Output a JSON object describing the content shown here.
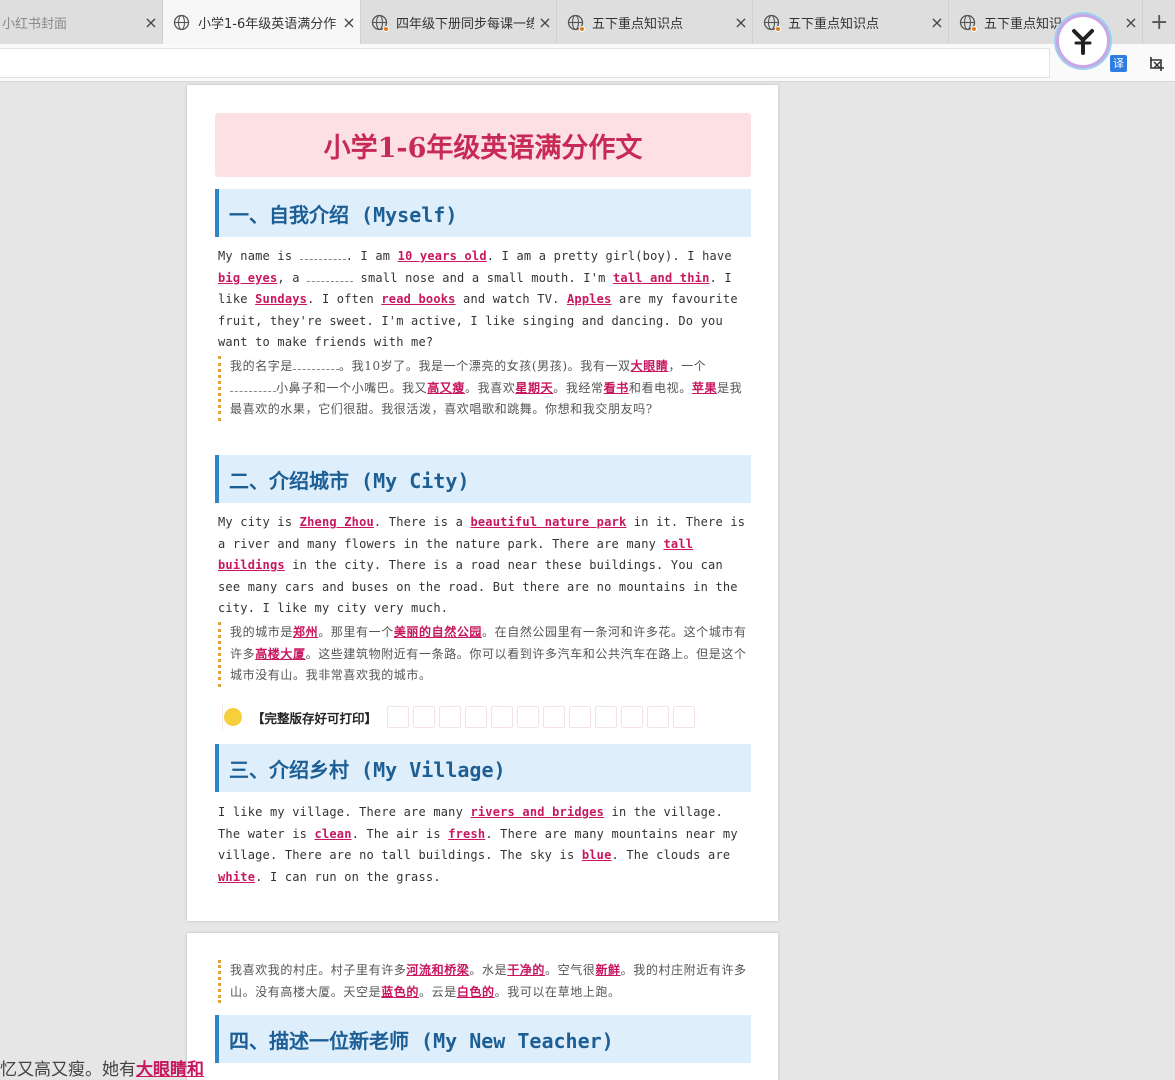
{
  "browser": {
    "tabs": [
      {
        "title": "小红书封面",
        "close": "×"
      },
      {
        "title": "小学1-6年级英语满分作",
        "close": "×"
      },
      {
        "title": "四年级下册同步每课一练",
        "close": "×"
      },
      {
        "title": "五下重点知识点",
        "close": "×"
      },
      {
        "title": "五下重点知识点",
        "close": "×"
      },
      {
        "title": "五下重点知识点",
        "close": "×"
      }
    ],
    "new_tab": "+",
    "translate_label": "译",
    "star": "☆"
  },
  "doc": {
    "title": "小学1-6年级英语满分作文",
    "sections": [
      {
        "heading": "一、自我介绍 (Myself)",
        "en": [
          {
            "t": "My name is "
          },
          {
            "blank": true
          },
          {
            "t": ". I am "
          },
          {
            "h": "10 years old"
          },
          {
            "t": ". I am a pretty girl(boy). I have "
          },
          {
            "h": "big eyes"
          },
          {
            "t": ", a "
          },
          {
            "blank": true
          },
          {
            "t": " small nose and a small mouth. I'm "
          },
          {
            "h": "tall and thin"
          },
          {
            "t": ". I like "
          },
          {
            "h": "Sundays"
          },
          {
            "t": ". I often "
          },
          {
            "h": "read books"
          },
          {
            "t": " and watch TV. "
          },
          {
            "h": "Apples"
          },
          {
            "t": " are my favourite fruit, they're sweet. I'm active, I like singing and dancing. Do you want to make friends with me?"
          }
        ],
        "cn": [
          {
            "t": "我的名字是"
          },
          {
            "blank": true
          },
          {
            "t": "。我10岁了。我是一个漂亮的女孩(男孩)。我有一双"
          },
          {
            "h": "大眼睛"
          },
          {
            "t": "，一个"
          },
          {
            "blank": true
          },
          {
            "t": "小鼻子和一个小嘴巴。我又"
          },
          {
            "h": "高又瘦"
          },
          {
            "t": "。我喜欢"
          },
          {
            "h": "星期天"
          },
          {
            "t": "。我经常"
          },
          {
            "h": "看书"
          },
          {
            "t": "和看电视。"
          },
          {
            "h": "苹果"
          },
          {
            "t": "是我最喜欢的水果，它们很甜。我很活泼，喜欢唱歌和跳舞。你想和我交朋友吗?"
          }
        ]
      },
      {
        "heading": "二、介绍城市 (My City)",
        "en": [
          {
            "t": "My city is "
          },
          {
            "h": "Zheng Zhou"
          },
          {
            "t": ". There is a "
          },
          {
            "h": "beautiful nature park"
          },
          {
            "t": " in it. There is a river and many flowers in the nature park. There are many "
          },
          {
            "h": "tall buildings"
          },
          {
            "t": " in the city. There is a road near these buildings. You can see many cars and buses on the road. But there are no mountains in the city. I like my city very much."
          }
        ],
        "cn": [
          {
            "t": "我的城市是"
          },
          {
            "h": "郑州"
          },
          {
            "t": "。那里有一个"
          },
          {
            "h": "美丽的自然公园"
          },
          {
            "t": "。在自然公园里有一条河和许多花。这个城市有许多"
          },
          {
            "h": "高楼大厦"
          },
          {
            "t": "。这些建筑物附近有一条路。你可以看到许多汽车和公共汽车在路上。但是这个城市没有山。我非常喜欢我的城市。"
          }
        ]
      },
      {
        "heading": "三、介绍乡村 (My Village)",
        "en": [
          {
            "t": "I like my village. There are many "
          },
          {
            "h": "rivers and bridges"
          },
          {
            "t": " in the village. The water is "
          },
          {
            "h": "clean"
          },
          {
            "t": ". The air is "
          },
          {
            "h": "fresh"
          },
          {
            "t": ". There are many mountains near my village. There are no tall buildings. The sky is "
          },
          {
            "h": "blue"
          },
          {
            "t": ". The clouds are "
          },
          {
            "h": "white"
          },
          {
            "t": ". I can run on the grass."
          }
        ],
        "cn": [
          {
            "t": "我喜欢我的村庄。村子里有许多"
          },
          {
            "h": "河流和桥梁"
          },
          {
            "t": "。水是"
          },
          {
            "h": "干净的"
          },
          {
            "t": "。空气很"
          },
          {
            "h": "新鲜"
          },
          {
            "t": "。我的村庄附近有许多山。没有高楼大厦。天空是"
          },
          {
            "h": "蓝色的"
          },
          {
            "t": "。云是"
          },
          {
            "h": "白色的"
          },
          {
            "t": "。我可以在草地上跑。"
          }
        ]
      },
      {
        "heading": "四、描述一位新老师 (My New Teacher)"
      }
    ],
    "print_banner": "【完整版存好可打印】",
    "bottom_clip": "忆又高又瘦。她有",
    "bottom_clip_highlight": "大眼睛和"
  },
  "colors": {
    "accent_pink": "#c8175f",
    "heading_blue": "#1d5f95",
    "title_bg": "#fde0e3"
  }
}
